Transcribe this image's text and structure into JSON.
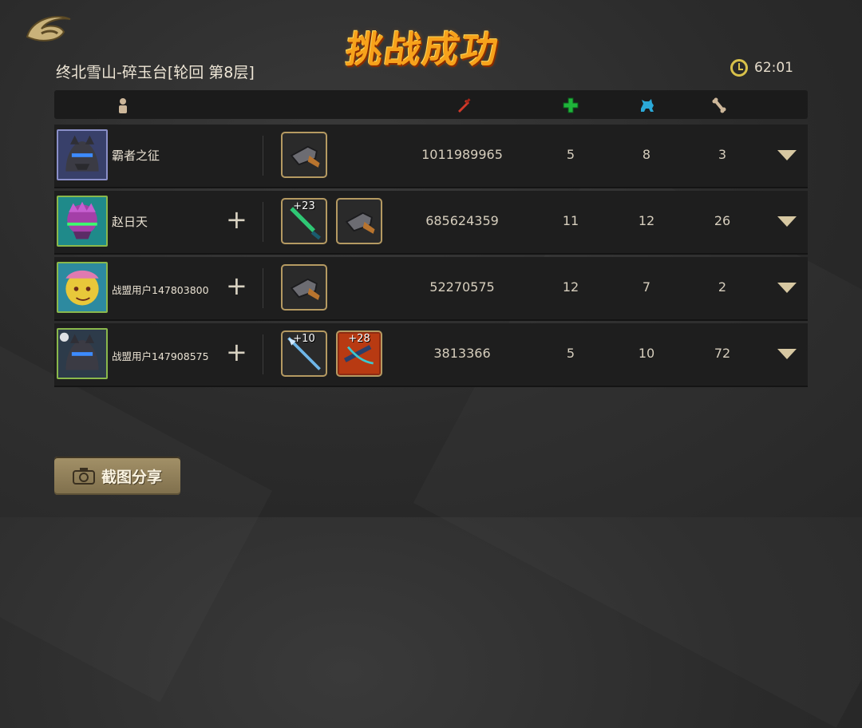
{
  "banner": {
    "title": "挑战成功"
  },
  "stage": {
    "title": "终北雪山-碎玉台[轮回 第8层]"
  },
  "timer": {
    "value": "62:01"
  },
  "columns": [
    "player-icon",
    "damage-icon",
    "heal-icon",
    "pet-icon",
    "bone-icon"
  ],
  "colors": {
    "damage": "#d23a2a",
    "heal": "#1fb43a",
    "pet": "#2ba9d8",
    "bone": "#cdb79a",
    "gold": "#b59a62"
  },
  "rows": [
    {
      "name": "霸者之征",
      "score": "1011989965",
      "heal": "5",
      "pet": "8",
      "bone": "3",
      "weapons": [
        {
          "level": ""
        }
      ]
    },
    {
      "name": "赵日天",
      "score": "685624359",
      "heal": "11",
      "pet": "12",
      "bone": "26",
      "weapons": [
        {
          "level": "+23"
        },
        {
          "level": ""
        }
      ]
    },
    {
      "name": "战盟用户147803800",
      "score": "52270575",
      "heal": "12",
      "pet": "7",
      "bone": "2",
      "weapons": [
        {
          "level": ""
        }
      ]
    },
    {
      "name": "战盟用户147908575",
      "score": "3813366",
      "heal": "5",
      "pet": "10",
      "bone": "72",
      "weapons": [
        {
          "level": "+10"
        },
        {
          "level": "+28"
        }
      ]
    }
  ],
  "share": {
    "label": "截图分享"
  }
}
